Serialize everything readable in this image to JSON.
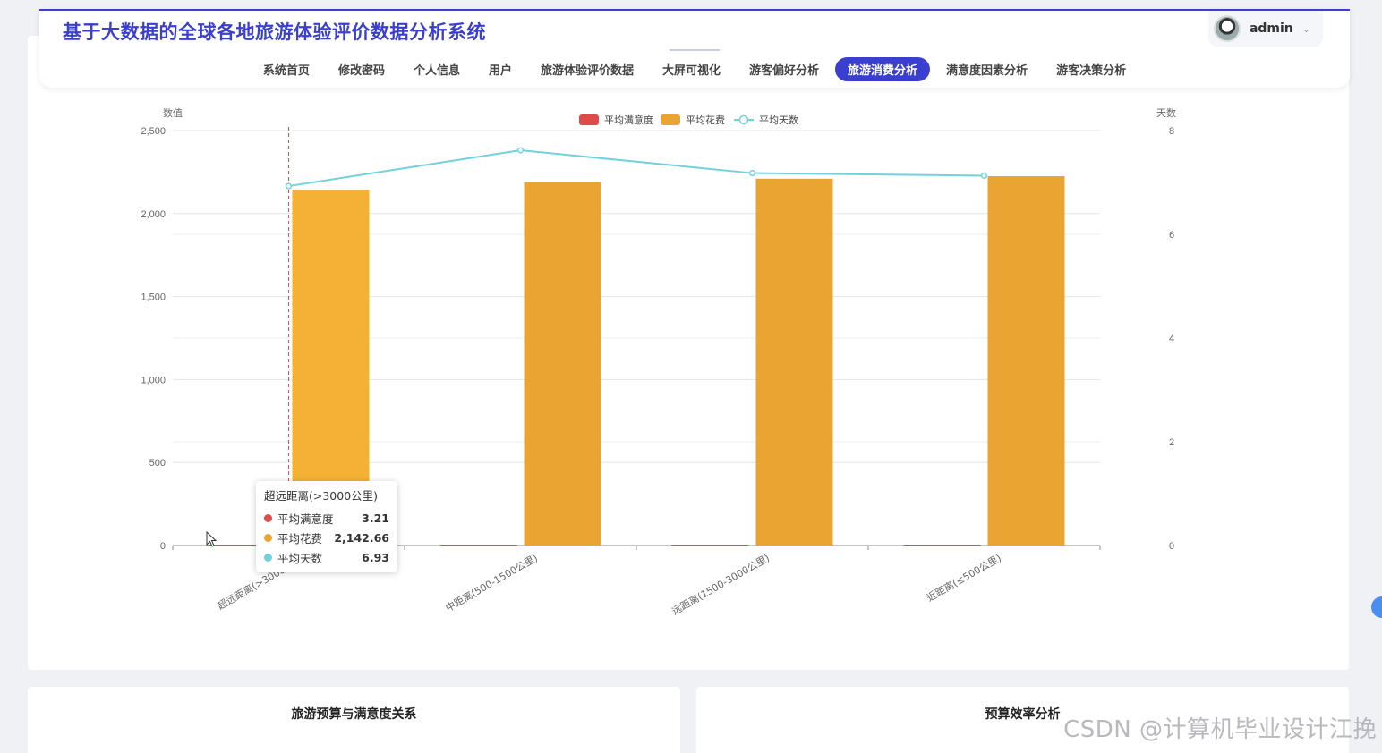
{
  "app": {
    "title": "基于大数据的全球各地旅游体验评价数据分析系统"
  },
  "user": {
    "name": "admin"
  },
  "nav": {
    "items": [
      {
        "label": "系统首页"
      },
      {
        "label": "修改密码"
      },
      {
        "label": "个人信息"
      },
      {
        "label": "用户"
      },
      {
        "label": "旅游体验评价数据"
      },
      {
        "label": "大屏可视化"
      },
      {
        "label": "游客偏好分析"
      },
      {
        "label": "旅游消费分析",
        "active": true
      },
      {
        "label": "满意度因素分析"
      },
      {
        "label": "游客决策分析"
      }
    ]
  },
  "colors": {
    "accent": "#3a3fd0",
    "satisfaction": "#dd4b4b",
    "spend": "#e9a432",
    "spend_highlight": "#f5b135",
    "days": "#72d1dc"
  },
  "chart_data": {
    "type": "bar",
    "categories": [
      "超远距离(>3000公里)",
      "中距离(500-1500公里)",
      "远距离(1500-3000公里)",
      "近距离(≤500公里)"
    ],
    "y_left": {
      "label": "数值",
      "ticks": [
        "0",
        "500",
        "1,000",
        "1,500",
        "2,000",
        "2,500"
      ],
      "lim": [
        0,
        2500
      ]
    },
    "y_right": {
      "label": "天数",
      "ticks": [
        "0",
        "2",
        "4",
        "6",
        "8"
      ],
      "lim": [
        0,
        8
      ]
    },
    "series": [
      {
        "name": "平均满意度",
        "type": "bar",
        "axis": "left",
        "values": [
          3.21,
          3.2,
          3.2,
          3.2
        ]
      },
      {
        "name": "平均花费",
        "type": "bar",
        "axis": "left",
        "values": [
          2142.66,
          2190,
          2210,
          2225
        ]
      },
      {
        "name": "平均天数",
        "type": "line",
        "axis": "right",
        "values": [
          6.93,
          7.62,
          7.18,
          7.13
        ]
      }
    ],
    "grid": true,
    "legend_position": "top-center",
    "x_label_rotation": -30,
    "highlight_index": 0
  },
  "tooltip": {
    "title": "超远距离(>3000公里)",
    "rows": [
      {
        "name": "平均满意度",
        "value": "3.21"
      },
      {
        "name": "平均花费",
        "value": "2,142.66"
      },
      {
        "name": "平均天数",
        "value": "6.93"
      }
    ]
  },
  "cards": {
    "left_title": "旅游预算与满意度关系",
    "right_title": "预算效率分析"
  },
  "watermark": "CSDN @计算机毕业设计江挽"
}
